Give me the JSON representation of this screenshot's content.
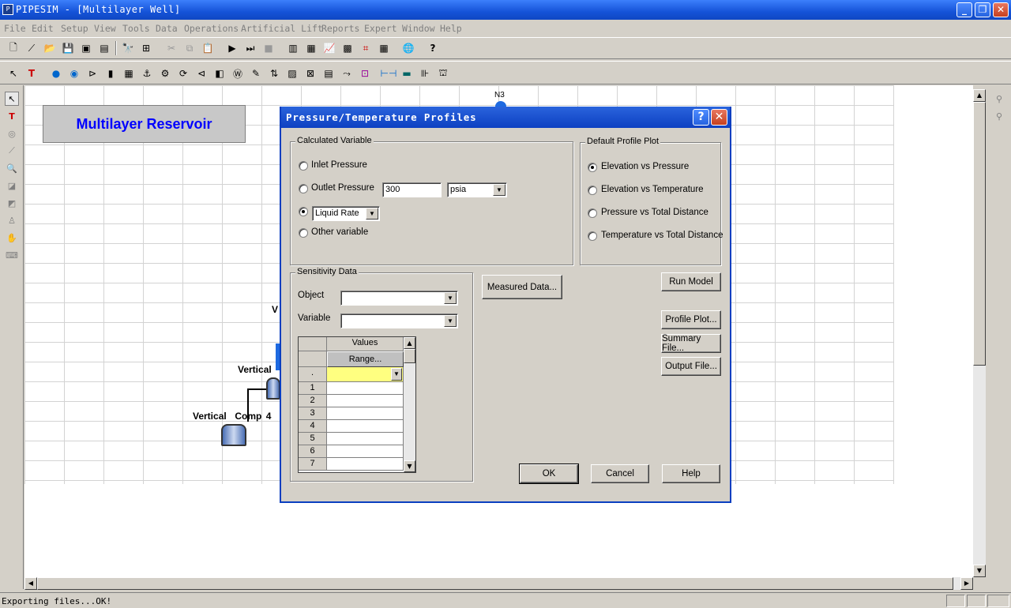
{
  "app": {
    "title": "PIPESIM - [Multilayer Well]",
    "icon": "pipesim-app-icon"
  },
  "menu": [
    "File",
    "Edit",
    "Setup",
    "View",
    "Tools",
    "Data",
    "Operations",
    "Artificial Lift",
    "Reports",
    "Expert",
    "Window",
    "Help"
  ],
  "canvas": {
    "banner": "Multilayer Reservoir",
    "node_n3": "N3",
    "label_v": "V",
    "label_vertical": "Vertical",
    "label_comp4": "Vertical  Comp 4"
  },
  "dialog": {
    "title": "Pressure/Temperature Profiles",
    "help_icon": "?",
    "calc_group": "Calculated Variable",
    "inlet_pressure": "Inlet Pressure",
    "outlet_pressure": "Outlet Pressure",
    "outlet_value": "300",
    "outlet_unit": "psia",
    "liquid_rate": "Liquid Rate",
    "other_variable": "Other variable",
    "plot_group": "Default Profile Plot",
    "plot_options": [
      "Elevation vs Pressure",
      "Elevation vs Temperature",
      "Pressure vs Total Distance",
      "Temperature vs Total Distance"
    ],
    "plot_selected": 0,
    "calc_selected": "Liquid Rate",
    "sens_group": "Sensitivity Data",
    "object_label": "Object",
    "variable_label": "Variable",
    "values_header": "Values",
    "range_button": "Range...",
    "dot_row": ".",
    "rows": [
      "1",
      "2",
      "3",
      "4",
      "5",
      "6",
      "7"
    ],
    "measured_data": "Measured Data...",
    "run_model": "Run Model",
    "profile_plot": "Profile Plot...",
    "summary_file": "Summary File...",
    "output_file": "Output File...",
    "ok": "OK",
    "cancel": "Cancel",
    "help": "Help"
  },
  "status": {
    "text": "Exporting files...OK!"
  },
  "colors": {
    "title_blue": "#0d40c2",
    "banner_text": "#0000ff",
    "highlight_cell": "#ffff80"
  }
}
